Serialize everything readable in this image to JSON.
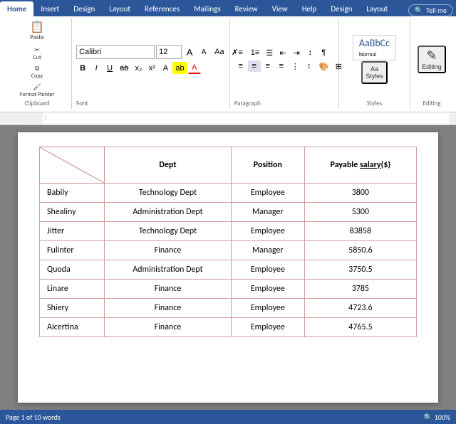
{
  "tabs": [
    {
      "label": "Home",
      "active": true
    },
    {
      "label": "Insert",
      "active": false
    },
    {
      "label": "Design",
      "active": false
    },
    {
      "label": "Layout",
      "active": false
    },
    {
      "label": "References",
      "active": false
    },
    {
      "label": "Mailings",
      "active": false
    },
    {
      "label": "Review",
      "active": false
    },
    {
      "label": "View",
      "active": false
    },
    {
      "label": "Help",
      "active": false
    },
    {
      "label": "Design",
      "active": false
    },
    {
      "label": "Layout",
      "active": false
    }
  ],
  "tell_me": "Tell me",
  "font": {
    "name": "Calibri",
    "size": "12",
    "placeholder_name": "Calibri",
    "placeholder_size": "12"
  },
  "groups": {
    "clipboard": "Clipboard",
    "font": "Font",
    "paragraph": "Paragraph",
    "styles": "Styles",
    "editing": "Editing"
  },
  "editing_label": "Editing",
  "styles_label": "Styles",
  "table": {
    "headers": [
      "",
      "Dept",
      "Position",
      "Payable salary($)"
    ],
    "rows": [
      {
        "name": "Babily",
        "dept": "Technology Dept",
        "position": "Employee",
        "salary": "3800"
      },
      {
        "name": "Shealiny",
        "dept": "Administration Dept",
        "position": "Manager",
        "salary": "5300"
      },
      {
        "name": "Jitter",
        "dept": "Technology Dept",
        "position": "Employee",
        "salary": "83858"
      },
      {
        "name": "Fulinter",
        "dept": "Finance",
        "position": "Manager",
        "salary": "5850.6"
      },
      {
        "name": "Quoda",
        "dept": "Administration Dept",
        "position": "Employee",
        "salary": "3750.5"
      },
      {
        "name": "Linare",
        "dept": "Finance",
        "position": "Employee",
        "salary": "3785"
      },
      {
        "name": "Shiery",
        "dept": "Finance",
        "position": "Employee",
        "salary": "4723.6"
      },
      {
        "name": "Aicertina",
        "dept": "Finance",
        "position": "Employee",
        "salary": "4765.5"
      }
    ]
  },
  "status": {
    "page": "Page 1 of 1",
    "words": "0 words"
  }
}
